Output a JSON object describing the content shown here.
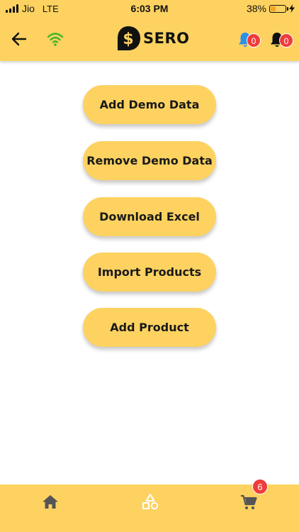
{
  "status_bar": {
    "carrier": "Jio",
    "network": "LTE",
    "time": "6:03 PM",
    "battery_percent_label": "38%",
    "battery_level": 0.38,
    "battery_color": "#f5a623"
  },
  "header": {
    "back_icon": "arrow-left-icon",
    "wifi_icon": "wifi-icon",
    "wifi_color": "#3cb528",
    "logo_text": "SERO",
    "notifications_blue": {
      "icon": "bell-icon",
      "color": "#2f8fe8",
      "count": "0"
    },
    "notifications_black": {
      "icon": "bell-icon",
      "color": "#111111",
      "count": "0"
    }
  },
  "actions": [
    {
      "label": "Add Demo Data"
    },
    {
      "label": "Remove Demo Data"
    },
    {
      "label": "Download Excel"
    },
    {
      "label": "Import Products"
    },
    {
      "label": "Add Product"
    }
  ],
  "tab_bar": {
    "home_icon": "home-icon",
    "categories_icon": "shapes-icon",
    "cart_icon": "cart-icon",
    "cart_count": "6"
  },
  "colors": {
    "accent": "#fdd260",
    "badge": "#ef3b3b",
    "icon_gray": "#555555"
  }
}
